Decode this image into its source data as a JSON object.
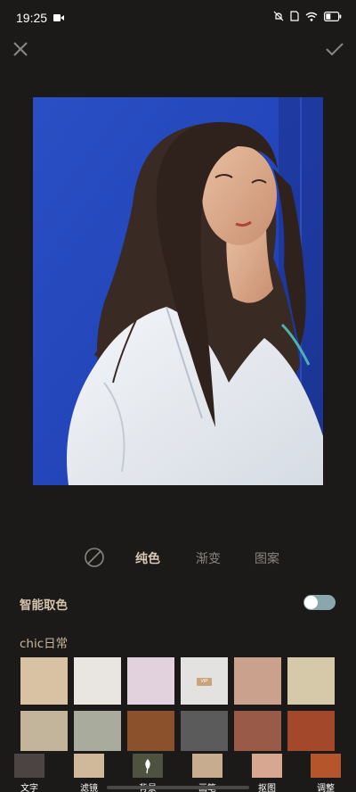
{
  "status": {
    "time": "19:25"
  },
  "tabs": {
    "solid": "纯色",
    "gradient": "渐变",
    "pattern": "图案"
  },
  "smart_color": {
    "label": "智能取色",
    "enabled": true
  },
  "palette": {
    "title": "chic日常",
    "vip_badge": "VIP",
    "colors": [
      "#d8c2a3",
      "#e9e5e1",
      "#e2d2dd",
      "#e3e2e1",
      "#c9a18c",
      "#d6c9aa",
      "#c2b59c",
      "#a9ab9d",
      "#8b512d",
      "#5b5b5b",
      "#9a5a48",
      "#a3482a"
    ]
  },
  "toolbar": {
    "items": [
      {
        "label": "文字",
        "color": "#4b4442"
      },
      {
        "label": "滤镜",
        "color": "#d0b89a"
      },
      {
        "label": "背景",
        "color": "#4e5240"
      },
      {
        "label": "画笔",
        "color": "#c8ac90"
      },
      {
        "label": "抠图",
        "color": "#d7a791"
      },
      {
        "label": "调整",
        "color": "#b5552b"
      }
    ]
  }
}
